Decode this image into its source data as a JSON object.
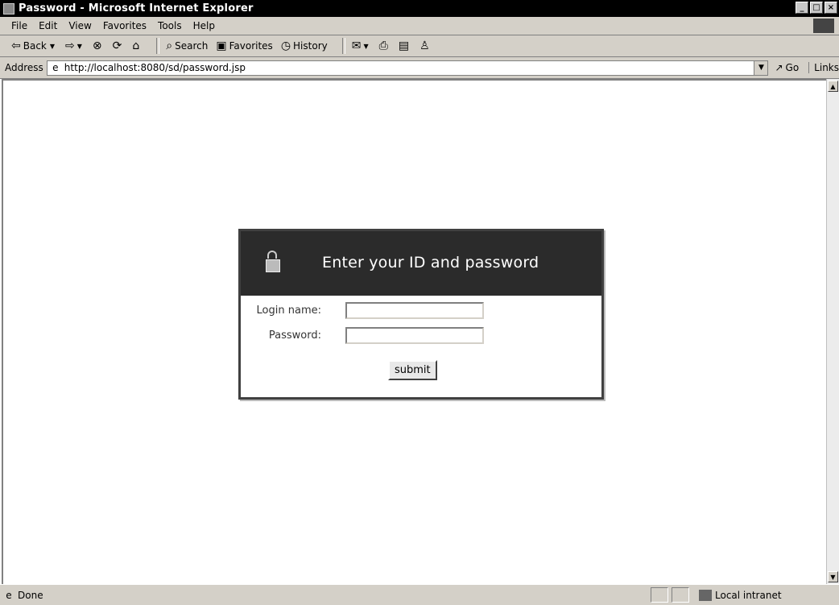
{
  "window": {
    "title": "Password - Microsoft Internet Explorer"
  },
  "menu": {
    "items": [
      "File",
      "Edit",
      "View",
      "Favorites",
      "Tools",
      "Help"
    ]
  },
  "toolbar": {
    "back_label": "Back",
    "search_label": "Search",
    "favorites_label": "Favorites",
    "history_label": "History"
  },
  "address": {
    "label": "Address",
    "url": "http://localhost:8080/sd/password.jsp",
    "go_label": "Go",
    "links_label": "Links"
  },
  "login": {
    "title": "Enter your ID and password",
    "login_label": "Login name:",
    "password_label": "Password:",
    "login_value": "",
    "password_value": "",
    "submit_label": "submit"
  },
  "status": {
    "text": "Done",
    "zone": "Local intranet"
  }
}
